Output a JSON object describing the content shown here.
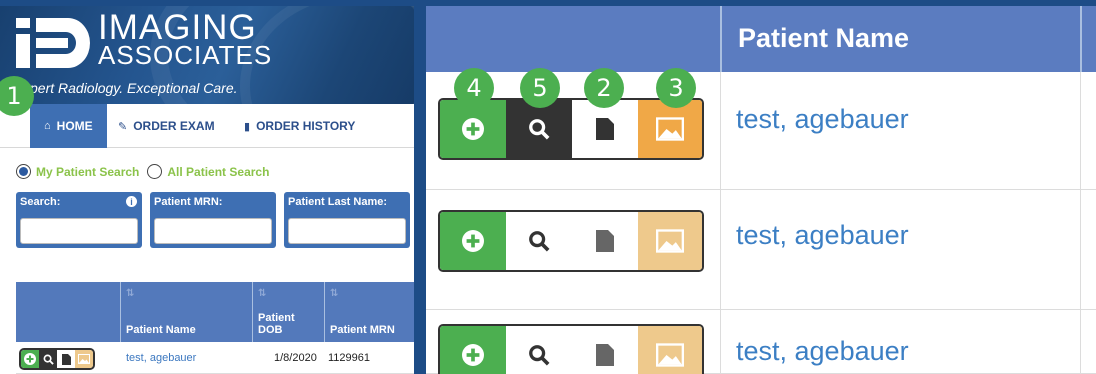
{
  "left_panel": {
    "logo": {
      "word1": "IMAGING",
      "word2": "ASSOCIATES"
    },
    "tagline": "pert Radiology. Exceptional Care.",
    "badge": "1",
    "nav": [
      {
        "label": "HOME",
        "icon": "home-icon"
      },
      {
        "label": "ORDER EXAM",
        "icon": "edit-icon"
      },
      {
        "label": "ORDER HISTORY",
        "icon": "book-icon"
      }
    ],
    "search_scope": [
      {
        "label": "My Patient Search",
        "selected": true
      },
      {
        "label": "All Patient Search",
        "selected": false
      }
    ],
    "search_fields": [
      {
        "label": "Search:",
        "value": ""
      },
      {
        "label": "Patient MRN:",
        "value": ""
      },
      {
        "label": "Patient Last Name:",
        "value": ""
      }
    ],
    "table": {
      "columns": [
        "Patient Name",
        "Patient DOB",
        "Patient MRN"
      ],
      "dob_line1": "Patient",
      "dob_line2": "DOB",
      "rows": [
        {
          "name": "test, agebauer",
          "dob": "1/8/2020",
          "mrn": "1129961"
        }
      ]
    }
  },
  "right_panel": {
    "header": "Patient Name",
    "badges": [
      "4",
      "5",
      "2",
      "3"
    ],
    "rows": [
      {
        "name": "test, agebauer"
      },
      {
        "name": "test, agebauer"
      },
      {
        "name": "test, agebauer"
      }
    ]
  },
  "colors": {
    "brand_blue": "#1d4c86",
    "header_blue": "#5b7cc0",
    "add_green": "#4caf50",
    "view_dark": "#333333",
    "image_orange": "#f0a847",
    "link_blue": "#3c7fc4",
    "badge_green": "#4caf50"
  }
}
